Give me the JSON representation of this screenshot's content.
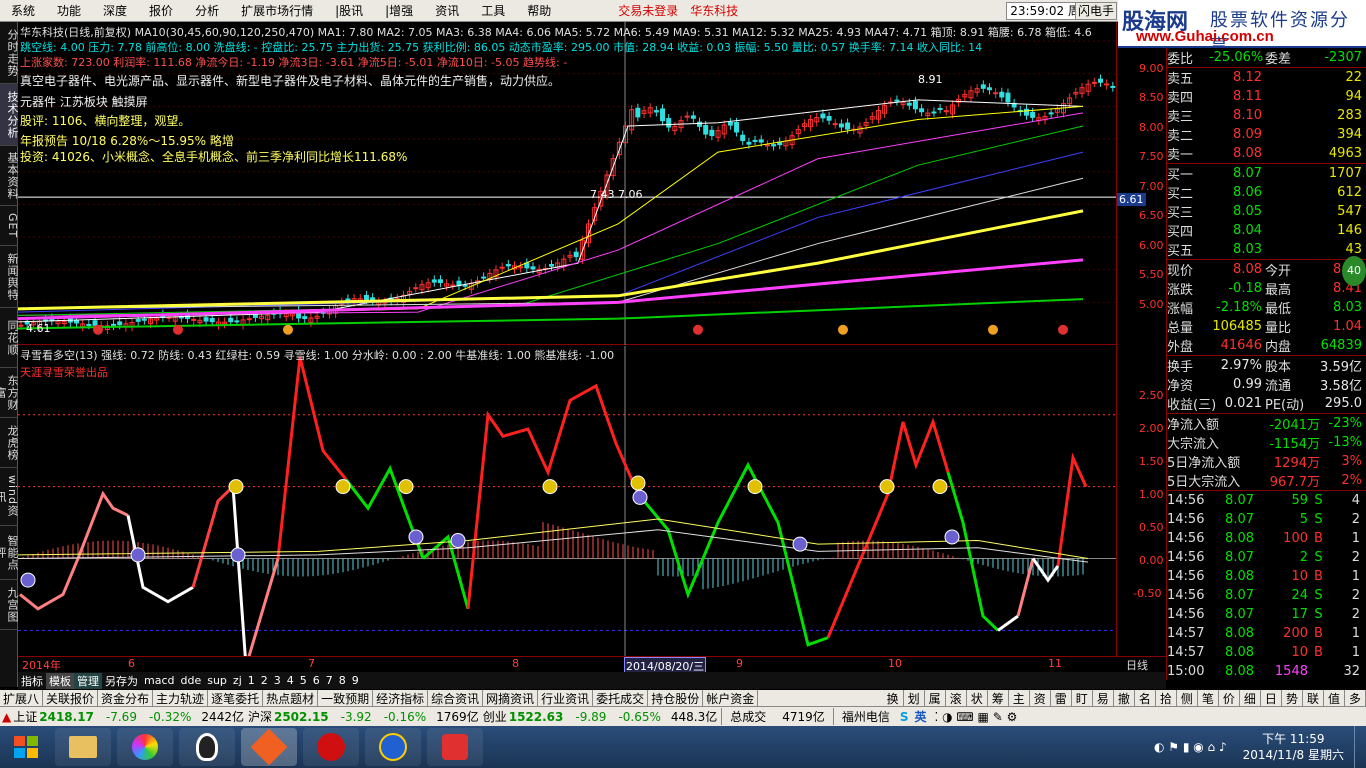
{
  "menu": {
    "items": [
      "系统",
      "功能",
      "深度",
      "报价",
      "分析",
      "扩展市场行情",
      "|股讯",
      "|增强",
      "资讯",
      "工具",
      "帮助"
    ],
    "alert": "交易未登录",
    "broker": "华东科技",
    "clock": "23:59:02 周六",
    "flash": "闪电手"
  },
  "logo": {
    "title": "股海网",
    "subtitle": "股票软件资源分享",
    "url": "www.Guhai.com.cn"
  },
  "left_tabs": [
    "分时走势",
    "技术分析",
    "基本资料",
    "GET",
    "新闻舆特",
    "同花顺",
    "东方财富",
    "龙虎榜",
    "wind资讯",
    "智能点评",
    "九宫图"
  ],
  "header": {
    "line1": "华东科技(日线,前复权) MA10(30,45,60,90,120,250,470) MA1: 7.80 MA2: 7.05 MA3: 6.38 MA4: 6.06 MA5: 5.72 MA6: 5.49 MA9: 5.31 MA12: 5.32 MA25: 4.93 MA47: 4.71 箱顶: 8.91 箱腰: 6.78 箱低: 4.6",
    "line2": "跳空线: 4.00  压力: 7.78  前高位: 8.00  洗盘线: -  控盘比: 25.75  主力出货: 25.75  获利比例: 86.05  动态市盈率: 295.00  市值: 28.94  收益: 0.03  振幅: 5.50  量比: 0.57  换手率: 7.14  收入同比: 14",
    "line3": "上涨家数: 723.00  利润率: 111.68  净流今日: -1.19  净流3日: -3.61  净流5日: -5.01  净流10日: -5.05  趋势线: -",
    "info1": "真空电子器件、电光源产品、显示器件、新型电子器件及电子材料、晶体元件的生产销售，动力供应。",
    "info2": "元器件 江苏板块 触摸屏",
    "info3": "股评: 1106、横向整理，观望。",
    "info4": "年报预告 10/18 6.28%～15.95% 略增",
    "info5": "投资: 41026、小米概念、全息手机概念、前三季净利同比增长111.68%",
    "price_label1": "7.43 7.06",
    "price_label2": "8.91",
    "low_label": "4.61"
  },
  "indicator": {
    "line1": "寻雪看多空(13) 强线: 0.72 防线: 0.43 红绿柱: 0.59 寻雪线: 1.00 分水岭: 0.00 : 2.00 牛基准线: 1.00 熊基准线: -1.00",
    "line2": "天涯寻雪荣誉出品"
  },
  "axis_main": [
    "9.00",
    "8.50",
    "8.00",
    "7.50",
    "7.00",
    "6.50",
    "6.00",
    "5.50",
    "5.00"
  ],
  "axis_main_marker": "6.61",
  "axis_ind": [
    "2.50",
    "2.00",
    "1.50",
    "1.00",
    "0.50",
    "0.00",
    "-0.50"
  ],
  "date_axis": [
    "2014年",
    "6",
    "7",
    "8",
    "2014/08/20/三",
    "9",
    "10",
    "11"
  ],
  "date_axis_right": "日线",
  "tool_tabs": [
    "指标",
    "模板",
    "管理",
    "另存为",
    "macd",
    "dde",
    "sup",
    "zj",
    "1",
    "2",
    "3",
    "4",
    "5",
    "6",
    "7",
    "8",
    "9"
  ],
  "chart_data": {
    "type": "candlestick",
    "title": "华东科技(日线,前复权)",
    "ylim": [
      4.5,
      9.2
    ],
    "xlabel": "",
    "ylabel": "",
    "months": [
      "2014年",
      "6",
      "7",
      "8",
      "9",
      "10",
      "11"
    ]
  },
  "quote": {
    "top": [
      [
        "委比",
        "-25.06%",
        "委差",
        "-2307"
      ]
    ],
    "sell": [
      [
        "卖五",
        "8.12",
        "22"
      ],
      [
        "卖四",
        "8.11",
        "94"
      ],
      [
        "卖三",
        "8.10",
        "283"
      ],
      [
        "卖二",
        "8.09",
        "394"
      ],
      [
        "卖一",
        "8.08",
        "4963"
      ]
    ],
    "buy": [
      [
        "买一",
        "8.07",
        "1707"
      ],
      [
        "买二",
        "8.06",
        "612"
      ],
      [
        "买三",
        "8.05",
        "547"
      ],
      [
        "买四",
        "8.04",
        "146"
      ],
      [
        "买五",
        "8.03",
        "43"
      ]
    ],
    "stats": [
      [
        "现价",
        "8.08",
        "今开",
        "8.10"
      ],
      [
        "涨跌",
        "-0.18",
        "最高",
        "8.41"
      ],
      [
        "涨幅",
        "-2.18%",
        "最低",
        "8.03"
      ],
      [
        "总量",
        "106485",
        "量比",
        "1.04"
      ],
      [
        "外盘",
        "41646",
        "内盘",
        "64839"
      ]
    ],
    "stats2": [
      [
        "换手",
        "2.97%",
        "股本",
        "3.59亿"
      ],
      [
        "净资",
        "0.99",
        "流通",
        "3.58亿"
      ],
      [
        "收益(三)",
        "0.021",
        "PE(动)",
        "295.0"
      ]
    ],
    "flow": [
      [
        "净流入额",
        "-2041万",
        "-23%"
      ],
      [
        "大宗流入",
        "-1154万",
        "-13%"
      ],
      [
        "5日净流入额",
        "1294万",
        "3%"
      ],
      [
        "5日大宗流入",
        "967.7万",
        "2%"
      ]
    ],
    "ticks": [
      [
        "14:56",
        "8.07",
        "59",
        "S",
        "4"
      ],
      [
        "14:56",
        "8.07",
        "5",
        "S",
        "2"
      ],
      [
        "14:56",
        "8.08",
        "100",
        "B",
        "1"
      ],
      [
        "14:56",
        "8.07",
        "2",
        "S",
        "2"
      ],
      [
        "14:56",
        "8.08",
        "10",
        "B",
        "1"
      ],
      [
        "14:56",
        "8.07",
        "24",
        "S",
        "2"
      ],
      [
        "14:56",
        "8.07",
        "17",
        "S",
        "2"
      ],
      [
        "14:57",
        "8.08",
        "200",
        "B",
        "1"
      ],
      [
        "14:57",
        "8.08",
        "10",
        "B",
        "1"
      ],
      [
        "15:00",
        "8.08",
        "1548",
        "",
        "32"
      ]
    ]
  },
  "bottom_tabs": [
    "扩展八",
    "关联报价",
    "资金分布",
    "主力轨迹",
    "逐笔委托",
    "热点题材",
    "一致预期",
    "经济指标",
    "综合资讯",
    "网摘资讯",
    "行业资讯",
    "委托成交",
    "持仓股份",
    "帐户资金"
  ],
  "bottom_right": [
    "换",
    "划",
    "属",
    "滚",
    "状",
    "筹",
    "主",
    "资",
    "雷",
    "盯",
    "易",
    "撤",
    "名",
    "拾",
    "侧",
    "笔",
    "价",
    "细",
    "日",
    "势",
    "联",
    "值",
    "多"
  ],
  "index_bar": {
    "sh": "上证",
    "sh_val": "2418.17",
    "sh_chg": "-7.69",
    "sh_pct": "-0.32%",
    "sh_amt": "2442亿",
    "hs": "沪深",
    "hs_val": "2502.15",
    "hs_chg": "-3.92",
    "hs_pct": "-0.16%",
    "hs_amt": "1769亿",
    "cy": "创业",
    "cy_val": "1522.63",
    "cy_chg": "-9.89",
    "cy_pct": "-0.65%",
    "cy_amt": "448.3亿",
    "deal": "总成交",
    "deal_val": "4719亿",
    "isp": "福州电信",
    "ime": "英"
  },
  "taskbar": {
    "time": "下午 11:59",
    "date": "2014/11/8 星期六"
  }
}
